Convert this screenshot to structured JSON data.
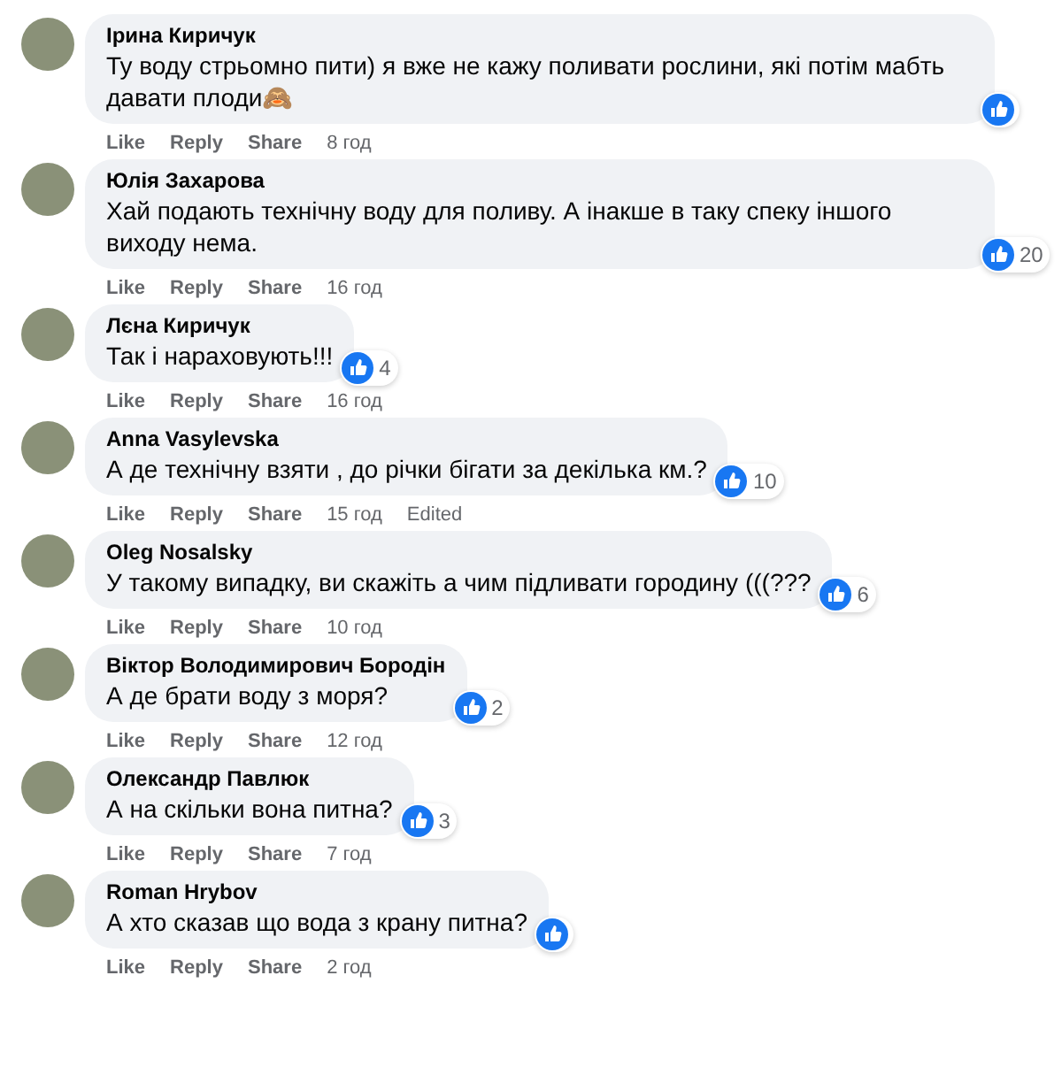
{
  "comments": [
    {
      "author": "Ірина Киричук",
      "text": "Ту воду стрьомно пити) я вже не кажу поливати рослини, які потім мабть давати плоди🙈",
      "actions": [
        "Like",
        "Reply",
        "Share"
      ],
      "time": "8 год"
    },
    {
      "author": "Юлія Захарова",
      "text": "Хай подають технічну воду для поливу. А інакше в таку спеку іншого виходу нема.",
      "reactions": "20",
      "actions": [
        "Like",
        "Reply",
        "Share"
      ],
      "time": "16 год"
    },
    {
      "author": "Лєна Киричук",
      "text": "Так і нараховують!!!",
      "reactions": "4",
      "actions": [
        "Like",
        "Reply",
        "Share"
      ],
      "time": "16 год"
    },
    {
      "author": "Anna Vasylevska",
      "text": "А де технічну взяти , до річки бігати за декілька км.?",
      "reactions": "10",
      "actions": [
        "Like",
        "Reply",
        "Share"
      ],
      "time": "15 год",
      "edited_label": "Edited"
    },
    {
      "author": "Oleg Nosalsky",
      "text": "У такому випадку, ви скажіть а чим підливати городину (((???",
      "reactions": "6",
      "actions": [
        "Like",
        "Reply",
        "Share"
      ],
      "time": "10 год"
    },
    {
      "author": "Віктор Володимирович Бородін",
      "text": "А де брати воду з моря?",
      "reactions": "2",
      "actions": [
        "Like",
        "Reply",
        "Share"
      ],
      "time": "12 год"
    },
    {
      "author": "Олександр Павлюк",
      "text": "А на скільки вона питна?",
      "reactions": "3",
      "actions": [
        "Like",
        "Reply",
        "Share"
      ],
      "time": "7 год"
    },
    {
      "author": "Roman Hrybov",
      "text": "А хто сказав що вода з крану питна?",
      "actions": [
        "Like",
        "Reply",
        "Share"
      ],
      "time": "2 год"
    }
  ]
}
